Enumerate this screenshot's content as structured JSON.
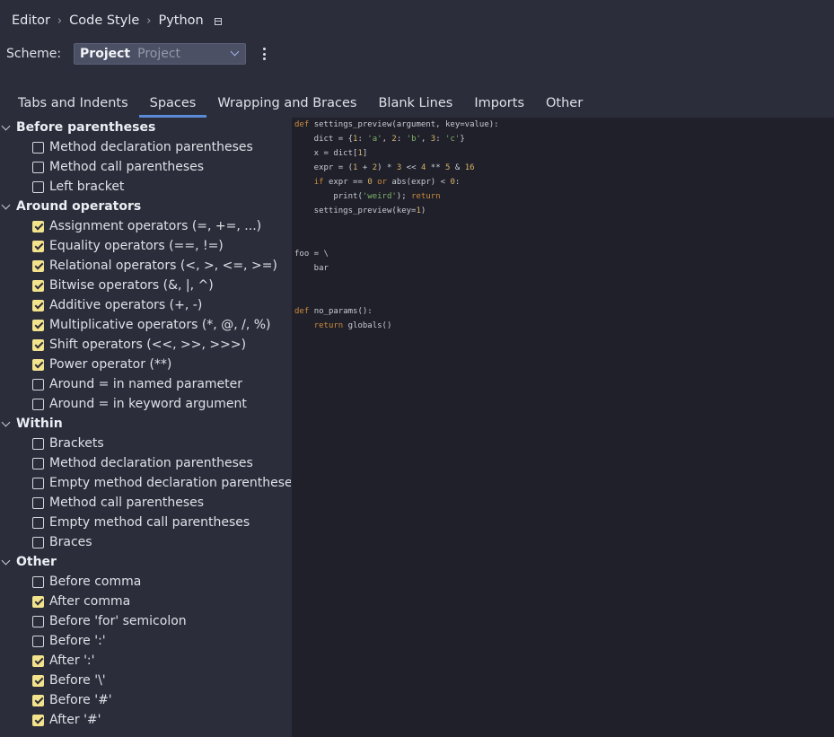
{
  "breadcrumb": {
    "items": [
      "Editor",
      "Code Style",
      "Python"
    ],
    "separator": "›"
  },
  "scheme": {
    "label": "Scheme:",
    "main": "Project",
    "sub": "Project"
  },
  "tabs": [
    {
      "label": "Tabs and Indents",
      "active": false
    },
    {
      "label": "Spaces",
      "active": true
    },
    {
      "label": "Wrapping and Braces",
      "active": false
    },
    {
      "label": "Blank Lines",
      "active": false
    },
    {
      "label": "Imports",
      "active": false
    },
    {
      "label": "Other",
      "active": false
    }
  ],
  "settings_tree": [
    {
      "type": "group",
      "label": "Before parentheses"
    },
    {
      "type": "option",
      "label": "Method declaration parentheses",
      "checked": false
    },
    {
      "type": "option",
      "label": "Method call parentheses",
      "checked": false
    },
    {
      "type": "option",
      "label": "Left bracket",
      "checked": false
    },
    {
      "type": "group",
      "label": "Around operators"
    },
    {
      "type": "option",
      "label": "Assignment operators (=, +=, ...)",
      "checked": true
    },
    {
      "type": "option",
      "label": "Equality operators (==, !=)",
      "checked": true
    },
    {
      "type": "option",
      "label": "Relational operators (<, >, <=, >=)",
      "checked": true
    },
    {
      "type": "option",
      "label": "Bitwise operators (&, |, ^)",
      "checked": true
    },
    {
      "type": "option",
      "label": "Additive operators (+, -)",
      "checked": true
    },
    {
      "type": "option",
      "label": "Multiplicative operators (*, @, /, %)",
      "checked": true
    },
    {
      "type": "option",
      "label": "Shift operators (<<, >>, >>>)",
      "checked": true
    },
    {
      "type": "option",
      "label": "Power operator (**)",
      "checked": true
    },
    {
      "type": "option",
      "label": "Around = in named parameter",
      "checked": false
    },
    {
      "type": "option",
      "label": "Around = in keyword argument",
      "checked": false
    },
    {
      "type": "group",
      "label": "Within"
    },
    {
      "type": "option",
      "label": "Brackets",
      "checked": false
    },
    {
      "type": "option",
      "label": "Method declaration parentheses",
      "checked": false
    },
    {
      "type": "option",
      "label": "Empty method declaration parentheses",
      "checked": false
    },
    {
      "type": "option",
      "label": "Method call parentheses",
      "checked": false
    },
    {
      "type": "option",
      "label": "Empty method call parentheses",
      "checked": false
    },
    {
      "type": "option",
      "label": "Braces",
      "checked": false
    },
    {
      "type": "group",
      "label": "Other"
    },
    {
      "type": "option",
      "label": "Before comma",
      "checked": false
    },
    {
      "type": "option",
      "label": "After comma",
      "checked": true
    },
    {
      "type": "option",
      "label": "Before 'for' semicolon",
      "checked": false
    },
    {
      "type": "option",
      "label": "Before ':'",
      "checked": false
    },
    {
      "type": "option",
      "label": "After ':'",
      "checked": true
    },
    {
      "type": "option",
      "label": "Before '\\'",
      "checked": true
    },
    {
      "type": "option",
      "label": "Before '#'",
      "checked": true
    },
    {
      "type": "option",
      "label": "After '#'",
      "checked": true
    }
  ],
  "code_preview": [
    [
      [
        "kw",
        "def "
      ],
      [
        "t",
        "settings_preview(argument, key=value):"
      ]
    ],
    [
      [
        "t",
        "    dict = {"
      ],
      [
        "num",
        "1"
      ],
      [
        "t",
        ": "
      ],
      [
        "str",
        "'a'"
      ],
      [
        "t",
        ", "
      ],
      [
        "num",
        "2"
      ],
      [
        "t",
        ": "
      ],
      [
        "str",
        "'b'"
      ],
      [
        "t",
        ", "
      ],
      [
        "num",
        "3"
      ],
      [
        "t",
        ": "
      ],
      [
        "str",
        "'c'"
      ],
      [
        "t",
        "}"
      ]
    ],
    [
      [
        "t",
        "    x = dict["
      ],
      [
        "num",
        "1"
      ],
      [
        "t",
        "]"
      ]
    ],
    [
      [
        "t",
        "    expr = ("
      ],
      [
        "num",
        "1"
      ],
      [
        "t",
        " + "
      ],
      [
        "num",
        "2"
      ],
      [
        "t",
        ") * "
      ],
      [
        "num",
        "3"
      ],
      [
        "t",
        " << "
      ],
      [
        "num",
        "4"
      ],
      [
        "t",
        " ** "
      ],
      [
        "num",
        "5"
      ],
      [
        "t",
        " & "
      ],
      [
        "num",
        "16"
      ]
    ],
    [
      [
        "t",
        "    "
      ],
      [
        "kw",
        "if "
      ],
      [
        "t",
        "expr == "
      ],
      [
        "num",
        "0"
      ],
      [
        "t",
        " "
      ],
      [
        "kw",
        "or "
      ],
      [
        "t",
        "abs(expr) < "
      ],
      [
        "num",
        "0"
      ],
      [
        "t",
        ":"
      ]
    ],
    [
      [
        "t",
        "        print("
      ],
      [
        "str",
        "'weird'"
      ],
      [
        "t",
        "); "
      ],
      [
        "kw",
        "return"
      ]
    ],
    [
      [
        "t",
        "    settings_preview(key="
      ],
      [
        "num",
        "1"
      ],
      [
        "t",
        ")"
      ]
    ],
    [],
    [],
    [
      [
        "t",
        "foo = \\"
      ]
    ],
    [
      [
        "t",
        "    bar"
      ]
    ],
    [],
    [],
    [
      [
        "kw",
        "def "
      ],
      [
        "t",
        "no_params():"
      ]
    ],
    [
      [
        "t",
        "    "
      ],
      [
        "kw",
        "return "
      ],
      [
        "t",
        "globals()"
      ]
    ]
  ],
  "colors": {
    "accent": "#5b8ad6",
    "checkbox_on": "#f3e38d",
    "keyword": "#cc8a3f",
    "number": "#d8b36a",
    "string": "#7fb26a"
  }
}
